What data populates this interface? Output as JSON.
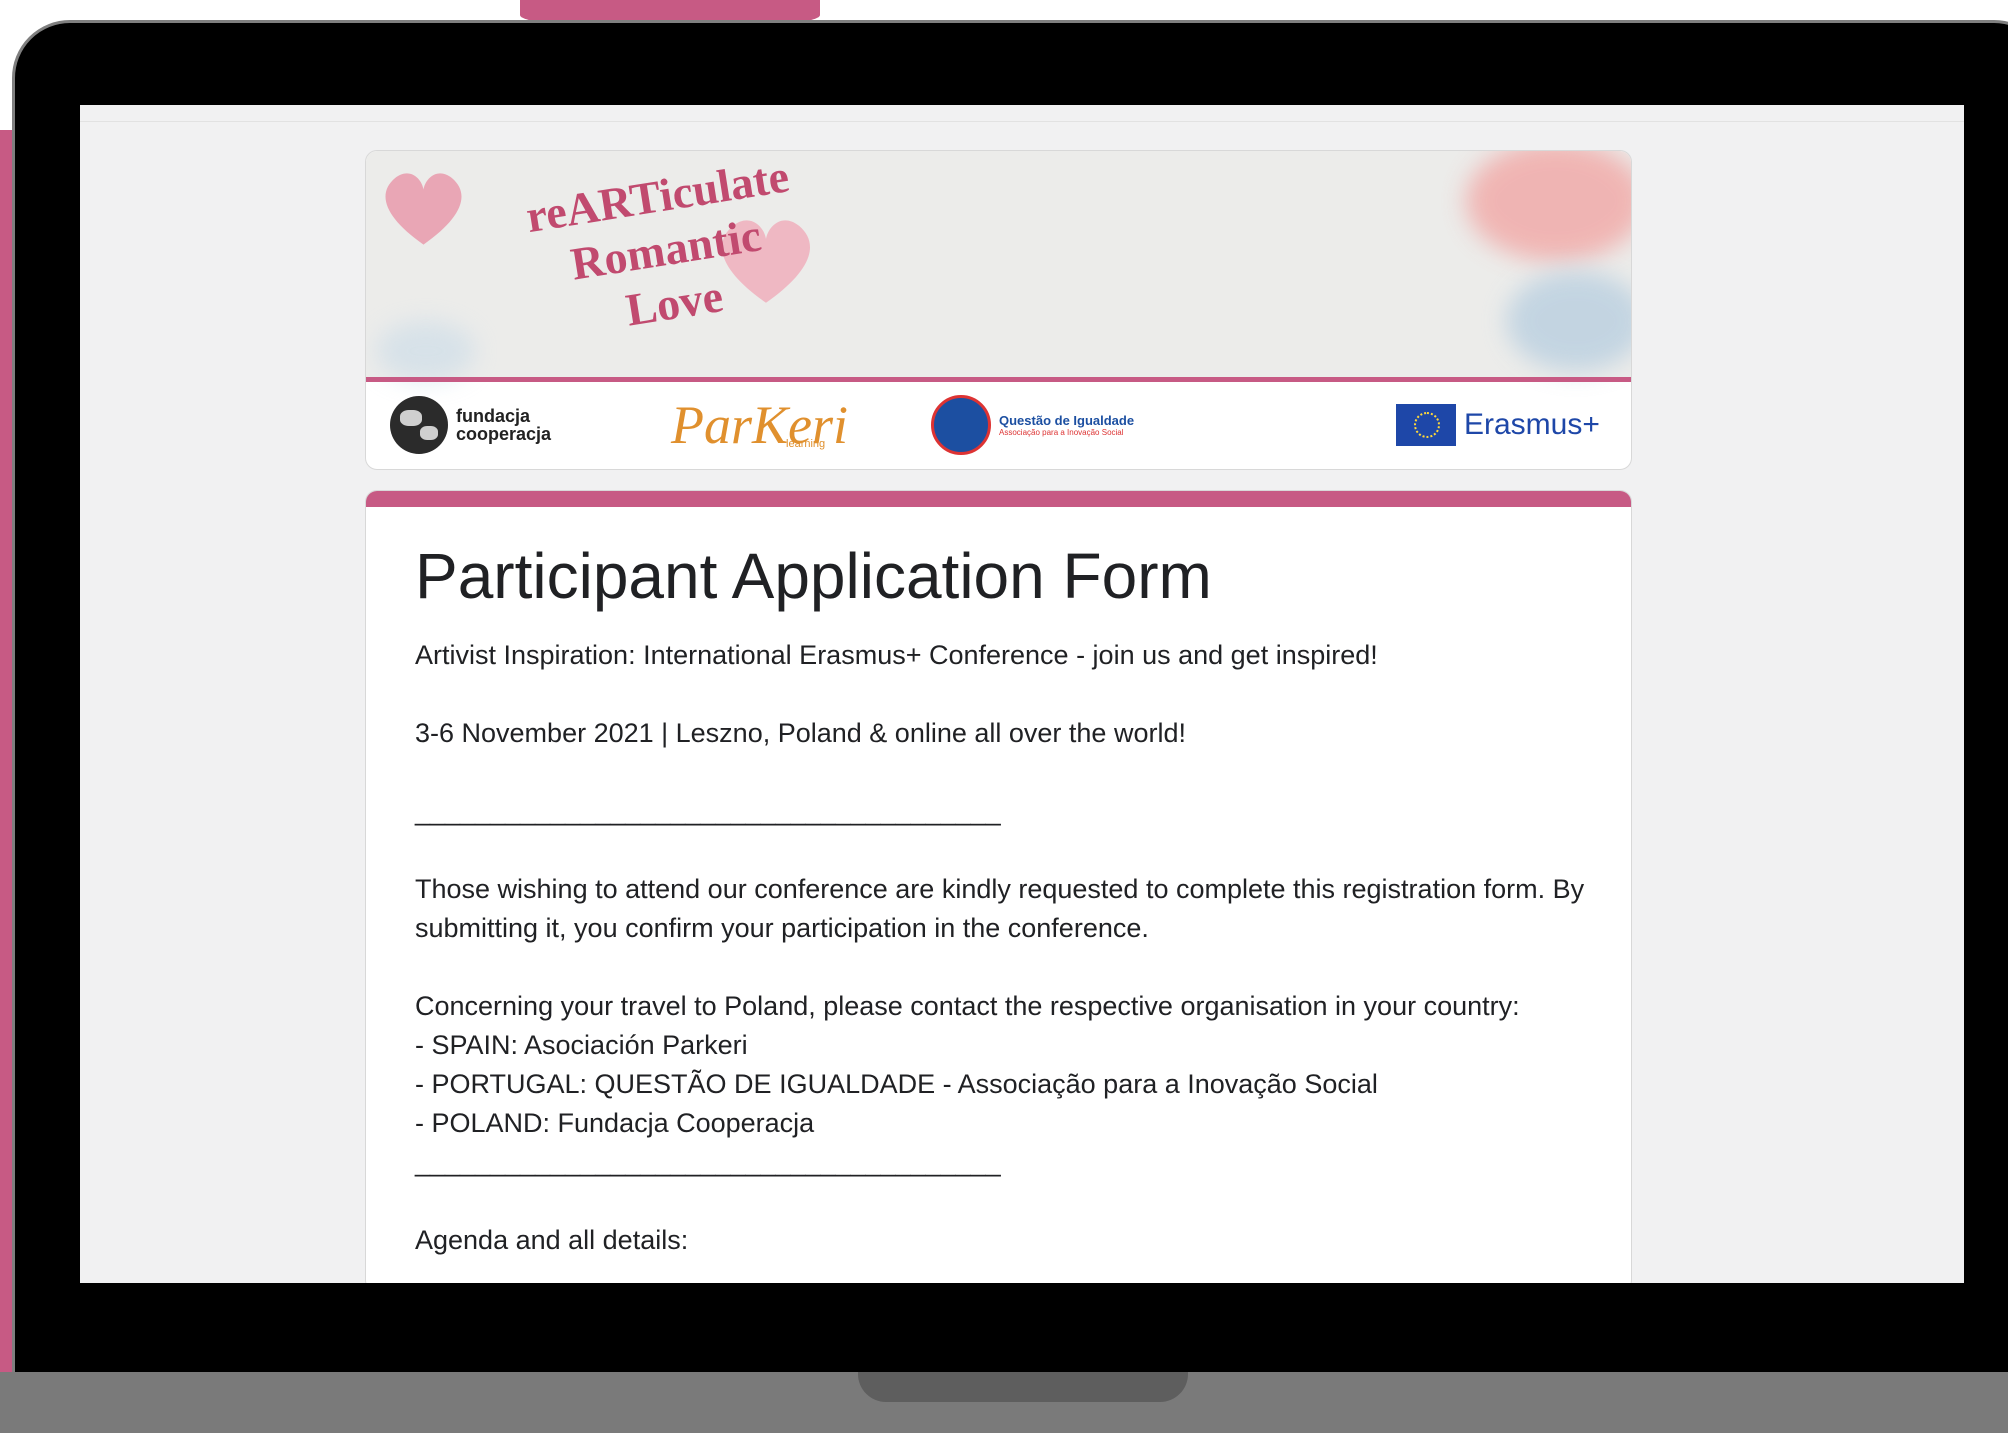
{
  "banner": {
    "title_line1": "reARTiculate",
    "title_line2": "Romantic",
    "title_line3": "Love"
  },
  "logos": {
    "fundacja_line1": "fundacja",
    "fundacja_line2": "cooperacja",
    "parkeri": "ParKeri",
    "parkeri_sub": "learning",
    "questao_title": "Questão de Igualdade",
    "questao_sub": "Associação para a Inovação Social",
    "erasmus": "Erasmus+"
  },
  "form": {
    "title": "Participant Application Form",
    "line_intro": "Artivist Inspiration: International Erasmus+ Conference - join us and get inspired!",
    "line_date": "3-6 November 2021 | Leszno, Poland & online all over the world!",
    "divider": "_______________________________________",
    "line_request": "Those wishing to attend our conference are kindly requested to complete this registration form. By submitting it, you confirm your participation in the conference.",
    "line_travel": "Concerning your travel to Poland, please contact the respective organisation in your country:",
    "contacts": [
      "- SPAIN: Asociación Parkeri",
      "- PORTUGAL: QUESTÃO DE IGUALDADE - Associação para a Inovação Social",
      "- POLAND: Fundacja Cooperacja"
    ],
    "line_agenda": "Agenda and all details:"
  },
  "colors": {
    "accent": "#c75a84",
    "text": "#202124",
    "page_bg": "#f1f1f2"
  }
}
